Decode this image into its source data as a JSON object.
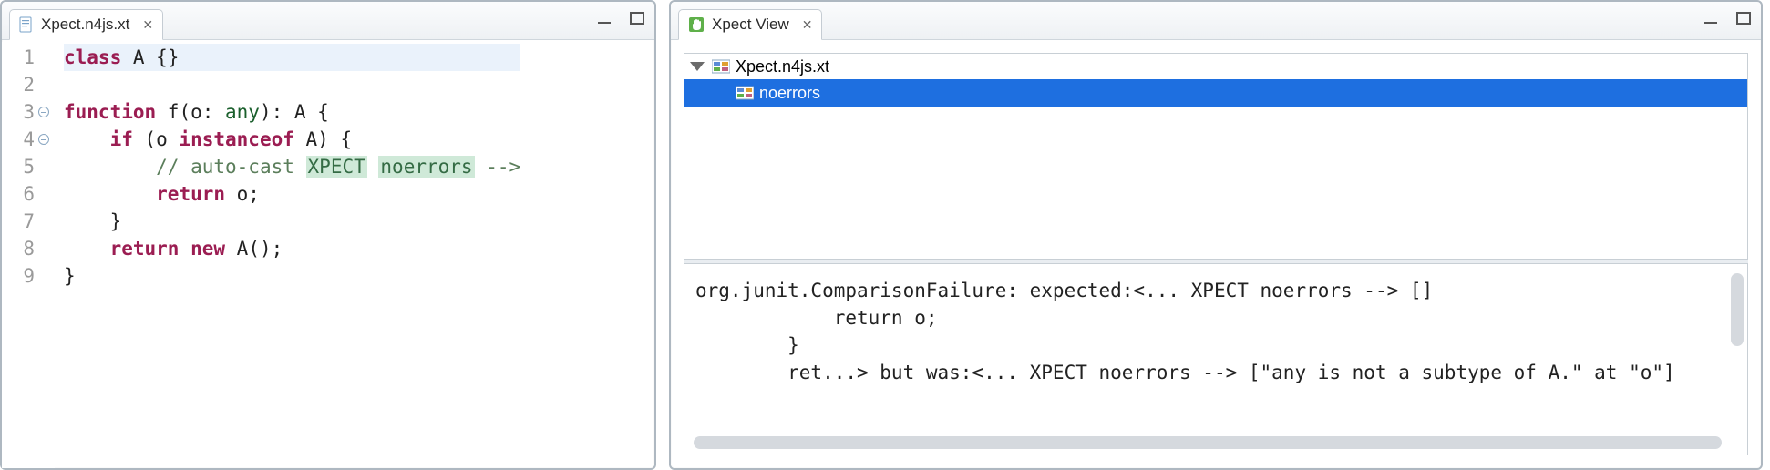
{
  "left": {
    "tab_label": "Xpect.n4js.xt",
    "line_numbers": [
      "1",
      "2",
      "3",
      "4",
      "5",
      "6",
      "7",
      "8",
      "9"
    ],
    "code": {
      "l1": {
        "kw": "class",
        "rest": " A {}"
      },
      "l3": {
        "kw": "function",
        "name": " f(o: ",
        "ty": "any",
        "mid": "): A {"
      },
      "l4": {
        "indent": "    ",
        "kw": "if",
        "rest": " (o ",
        "kw2": "instanceof",
        "rest2": " A) {"
      },
      "l5": {
        "indent": "        ",
        "cm_pre": "// auto-cast ",
        "xp_key": "XPECT",
        "sp": " ",
        "xp_name": "noerrors",
        "cm_post": " -->"
      },
      "l6": {
        "indent": "        ",
        "kw": "return",
        "rest": " o;"
      },
      "l7": {
        "indent": "    ",
        "rest": "}"
      },
      "l8": {
        "indent": "    ",
        "kw": "return",
        "rest": " ",
        "kw2": "new",
        "rest2": " A();"
      },
      "l9": {
        "rest": "}"
      }
    }
  },
  "right": {
    "tab_label": "Xpect View",
    "tree": {
      "root": "Xpect.n4js.xt",
      "child": "noerrors"
    },
    "detail": {
      "l1": "org.junit.ComparisonFailure: expected:<... XPECT noerrors --> []",
      "l2": "            return o;",
      "l3": "        }",
      "l4": "        ret...> but was:<... XPECT noerrors --> [\"any is not a subtype of A.\" at \"o\"]"
    }
  }
}
